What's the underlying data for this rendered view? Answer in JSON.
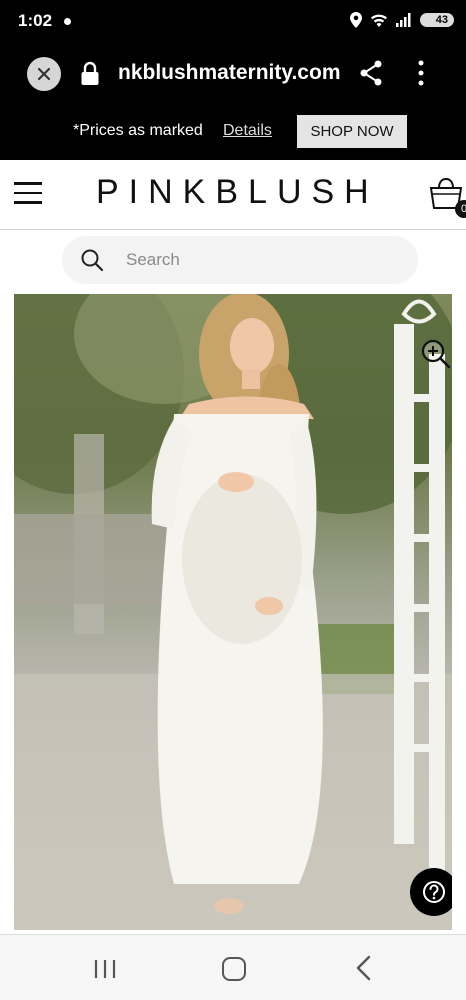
{
  "status": {
    "time": "1:02",
    "battery": "43"
  },
  "browser": {
    "url": "nkblushmaternity.com"
  },
  "promo": {
    "text": "*Prices as marked",
    "link": "Details",
    "button": "SHOP NOW"
  },
  "header": {
    "logo": "PINKBLUSH",
    "cart_count": "0"
  },
  "search": {
    "placeholder": "Search"
  },
  "icons": {
    "close": "close-icon",
    "lock": "lock-icon",
    "share": "share-icon",
    "menu": "more-vert-icon",
    "hamburger": "hamburger-icon",
    "bag": "shopping-bag-icon",
    "search": "search-icon",
    "zoom": "zoom-in-icon",
    "help": "help-icon"
  }
}
